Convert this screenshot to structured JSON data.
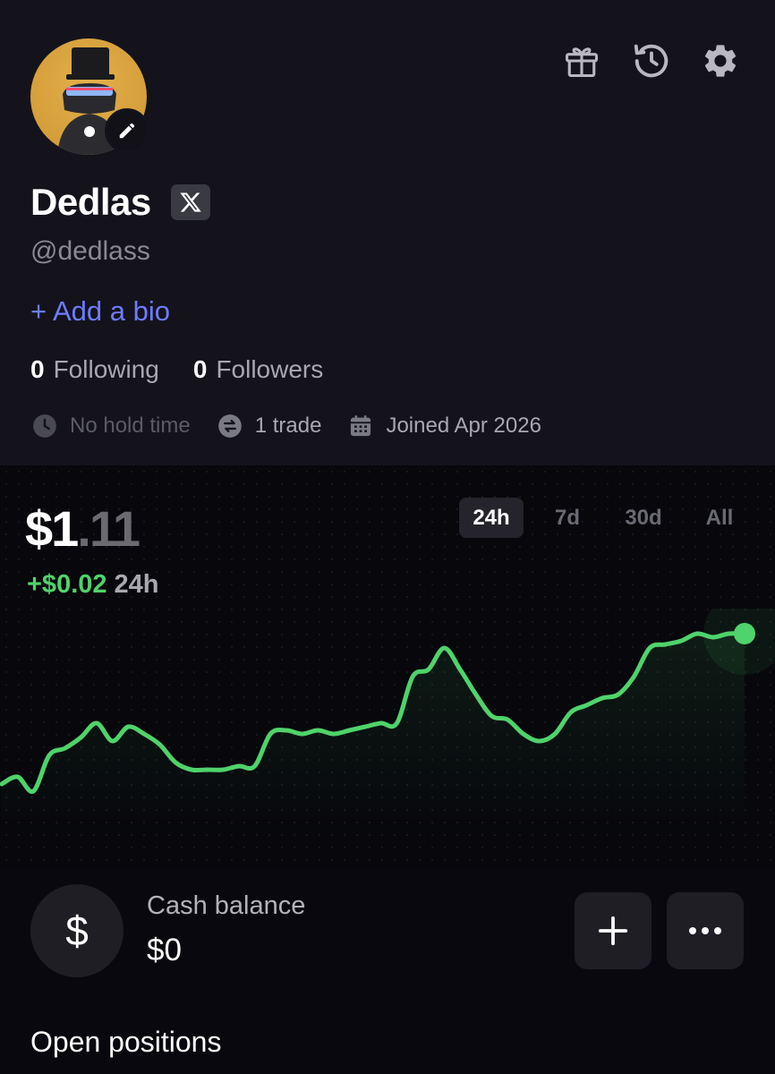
{
  "profile": {
    "name": "Dedlas",
    "handle": "@dedlass",
    "add_bio": "+ Add a bio",
    "following_count": "0",
    "following_label": "Following",
    "followers_count": "0",
    "followers_label": "Followers",
    "hold_time": "No hold time",
    "trades": "1 trade",
    "joined": "Joined Apr 2026"
  },
  "header_icons": [
    "gift-icon",
    "history-icon",
    "settings-icon"
  ],
  "portfolio": {
    "balance_main": "$1",
    "balance_cents": ".11",
    "change_value": "+$0.02",
    "change_period": "24h",
    "ranges": [
      "24h",
      "7d",
      "30d",
      "All"
    ],
    "active_range": "24h"
  },
  "chart_data": {
    "type": "line",
    "title": "",
    "xlabel": "",
    "ylabel": "",
    "color": "#4fd36b",
    "x": [
      0,
      1,
      2,
      3,
      4,
      5,
      6,
      7,
      8,
      9,
      10,
      11,
      12,
      13,
      14,
      15,
      16,
      17,
      18,
      19,
      20,
      21,
      22,
      23,
      24,
      25,
      26,
      27,
      28,
      29,
      30,
      31,
      32,
      33,
      34,
      35,
      36,
      37,
      38,
      39,
      40,
      41,
      42,
      43,
      44,
      45,
      46,
      47
    ],
    "values": [
      1.086,
      1.088,
      1.084,
      1.094,
      1.096,
      1.099,
      1.103,
      1.098,
      1.102,
      1.1,
      1.097,
      1.092,
      1.09,
      1.09,
      1.09,
      1.091,
      1.091,
      1.1,
      1.101,
      1.1,
      1.101,
      1.1,
      1.101,
      1.102,
      1.103,
      1.103,
      1.116,
      1.118,
      1.124,
      1.118,
      1.111,
      1.105,
      1.104,
      1.1,
      1.098,
      1.1,
      1.106,
      1.108,
      1.11,
      1.111,
      1.116,
      1.124,
      1.125,
      1.126,
      1.128,
      1.127,
      1.128,
      1.128
    ],
    "ylim": [
      1.08,
      1.13
    ]
  },
  "cash": {
    "label": "Cash balance",
    "value": "$0",
    "symbol": "$"
  },
  "positions": {
    "title": "Open positions"
  },
  "colors": {
    "accent_blue": "#6e7cff",
    "positive_green": "#4fd36b",
    "avatar_gold": "#d9a640"
  }
}
